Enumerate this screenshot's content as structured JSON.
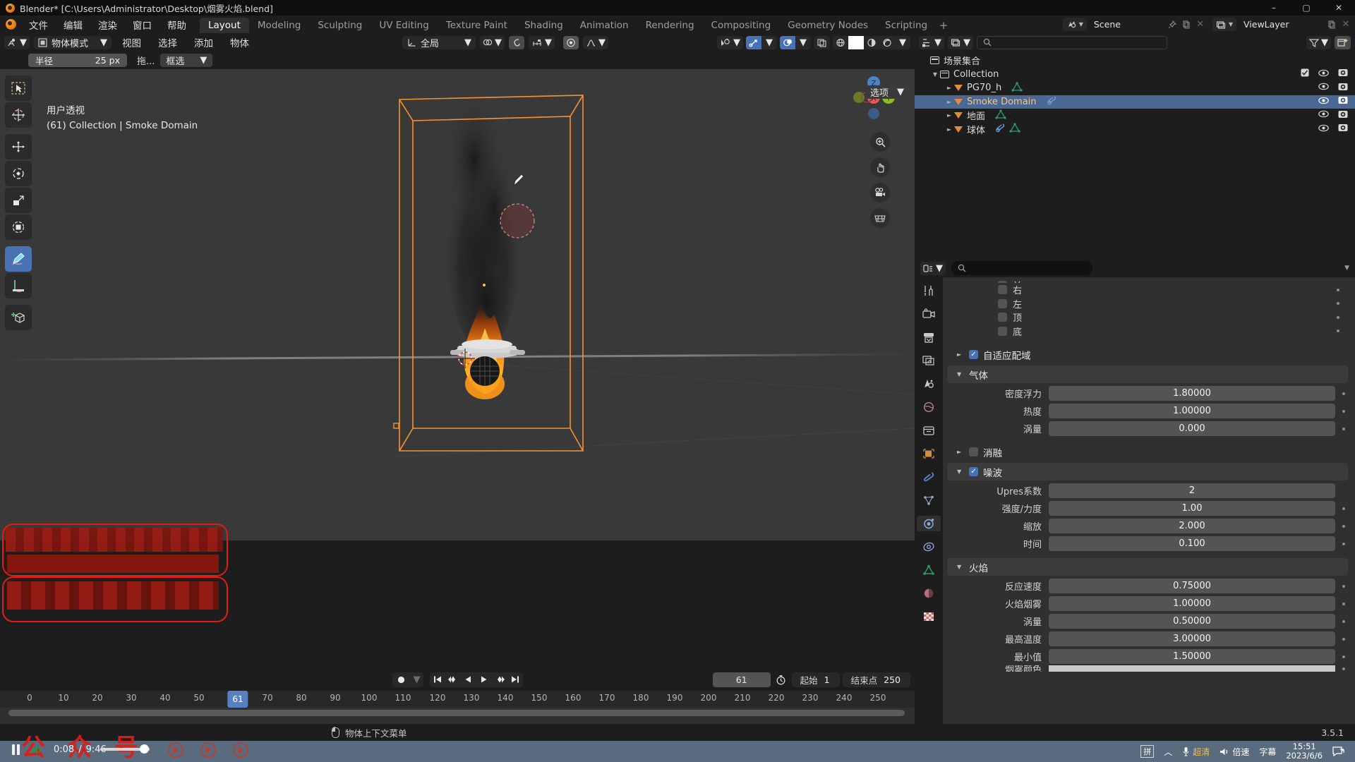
{
  "window": {
    "title": "Blender* [C:\\Users\\Administrator\\Desktop\\烟雾火焰.blend]",
    "minimize": "–",
    "maximize": "▢",
    "close": "✕"
  },
  "topbar": {
    "menus": [
      "文件",
      "编辑",
      "渲染",
      "窗口",
      "帮助"
    ],
    "workspaces": [
      "Layout",
      "Modeling",
      "Sculpting",
      "UV Editing",
      "Texture Paint",
      "Shading",
      "Animation",
      "Rendering",
      "Compositing",
      "Geometry Nodes",
      "Scripting"
    ],
    "active_workspace": "Layout",
    "add_workspace": "+",
    "scene_name": "Scene",
    "viewlayer_name": "ViewLayer"
  },
  "viewport": {
    "header": {
      "mode": "物体模式",
      "menus": [
        "视图",
        "选择",
        "添加",
        "物体"
      ],
      "transform_orientation": "全局",
      "overlay_label": "",
      "icons": {
        "editor_type": "editor-type-icon",
        "mode_icon": "object-mode-icon",
        "orientation_icon": "global-orientation-icon",
        "snap_icon": "magnet-icon",
        "proportional_icon": "proportional-edit-icon",
        "falloff_icon": "falloff-curve-icon",
        "visibility_icon": "object-visibility-icon",
        "gizmo_icon": "gizmo-icon",
        "overlays_icon": "overlays-icon",
        "xray_icon": "xray-icon"
      },
      "shading_modes": [
        "wireframe",
        "solid",
        "material",
        "rendered"
      ],
      "active_shading": "solid"
    },
    "tool_settings": {
      "radius_label": "半径",
      "radius_value": "25 px",
      "drag_label": "拖...",
      "placement_value": "框选"
    },
    "options_label": "选项",
    "overlay_text_line1": "用户透视",
    "overlay_text_line2": "(61) Collection | Smoke Domain",
    "gizmo_axes": [
      "Z",
      "X",
      "Y"
    ],
    "tools": [
      {
        "name": "tweak-tool",
        "label": "调整"
      },
      {
        "name": "cursor-tool",
        "label": "游标"
      },
      {
        "name": "move-tool",
        "label": "移动"
      },
      {
        "name": "rotate-tool",
        "label": "旋转"
      },
      {
        "name": "scale-tool",
        "label": "缩放"
      },
      {
        "name": "transform-tool",
        "label": "变换"
      },
      {
        "name": "annotate-tool",
        "label": "标注"
      },
      {
        "name": "measure-tool",
        "label": "测量"
      },
      {
        "name": "add-cube-tool",
        "label": "添加立方体"
      }
    ],
    "active_tool": "annotate-tool"
  },
  "outliner": {
    "filter_placeholder": "",
    "root_label": "场景集合",
    "items": [
      {
        "label": "Collection",
        "type": "collection",
        "depth": 0,
        "selected": false,
        "has_checkbox": true,
        "modifier_icons": []
      },
      {
        "label": "PG70_h",
        "type": "object",
        "depth": 1,
        "selected": false,
        "has_checkbox": false,
        "modifier_icons": [
          "mesh-data-icon"
        ]
      },
      {
        "label": "Smoke Domain",
        "type": "object",
        "depth": 1,
        "selected": true,
        "has_checkbox": false,
        "modifier_icons": [
          "physics-icon"
        ]
      },
      {
        "label": "地面",
        "type": "object",
        "depth": 1,
        "selected": false,
        "has_checkbox": false,
        "modifier_icons": [
          "mesh-data-icon"
        ]
      },
      {
        "label": "球体",
        "type": "object",
        "depth": 1,
        "selected": false,
        "has_checkbox": false,
        "modifier_icons": [
          "physics-icon",
          "mesh-data-icon"
        ]
      }
    ]
  },
  "properties": {
    "search_placeholder": "",
    "tabs": [
      "tool-tab",
      "render-tab",
      "output-tab",
      "viewlayer-tab",
      "scene-tab",
      "world-tab",
      "collection-tab",
      "object-tab",
      "modifier-tab",
      "particles-tab",
      "physics-tab",
      "constraint-tab",
      "data-tab",
      "material-tab",
      "texture-tab"
    ],
    "active_tab": "physics-tab",
    "partial_checkboxes": [
      {
        "label": "右",
        "checked": false
      },
      {
        "label": "左",
        "checked": false
      },
      {
        "label": "顶",
        "checked": false
      },
      {
        "label": "底",
        "checked": false
      }
    ],
    "sections": [
      {
        "name": "adaptive-domain",
        "title": "自适应配域",
        "checkbox": true,
        "collapsed": true,
        "rows": []
      },
      {
        "name": "gas-section",
        "title": "气体",
        "checkbox": null,
        "collapsed": false,
        "rows": [
          {
            "label": "密度浮力",
            "value": "1.80000"
          },
          {
            "label": "热度",
            "value": "1.00000"
          },
          {
            "label": "涡量",
            "value": "0.000"
          }
        ]
      },
      {
        "name": "dissolve-section",
        "title": "消融",
        "checkbox": false,
        "collapsed": true,
        "rows": []
      },
      {
        "name": "noise-section",
        "title": "噪波",
        "checkbox": true,
        "collapsed": false,
        "rows": [
          {
            "label": "Upres系数",
            "value": "2",
            "no_dot": true
          },
          {
            "label": "强度/力度",
            "value": "1.00"
          },
          {
            "label": "缩放",
            "value": "2.000"
          },
          {
            "label": "时间",
            "value": "0.100"
          }
        ]
      },
      {
        "name": "fire-section",
        "title": "火焰",
        "checkbox": null,
        "collapsed": false,
        "rows": [
          {
            "label": "反应速度",
            "value": "0.75000"
          },
          {
            "label": "火焰烟雾",
            "value": "1.00000"
          },
          {
            "label": "涡量",
            "value": "0.50000"
          },
          {
            "label": "最高温度",
            "value": "3.00000"
          },
          {
            "label": "最小值",
            "value": "1.50000"
          }
        ]
      }
    ],
    "clipped_row_label": "烟雾颜色"
  },
  "timeline": {
    "playback_icons": [
      "jump-start-icon",
      "prev-keyframe-icon",
      "play-reverse-icon",
      "play-icon",
      "next-keyframe-icon",
      "jump-end-icon"
    ],
    "record_icon": "record-icon",
    "current_frame": "61",
    "timer_icon": "timer-icon",
    "start_label": "起始",
    "start_value": "1",
    "end_label": "结束点",
    "end_value": "250",
    "ticks": [
      {
        "label": "0",
        "frame": 0
      },
      {
        "label": "10",
        "frame": 10
      },
      {
        "label": "20",
        "frame": 20
      },
      {
        "label": "30",
        "frame": 30
      },
      {
        "label": "40",
        "frame": 40
      },
      {
        "label": "50",
        "frame": 50
      },
      {
        "label": "70",
        "frame": 70
      },
      {
        "label": "80",
        "frame": 80
      },
      {
        "label": "90",
        "frame": 90
      },
      {
        "label": "100",
        "frame": 100
      },
      {
        "label": "110",
        "frame": 110
      },
      {
        "label": "120",
        "frame": 120
      },
      {
        "label": "130",
        "frame": 130
      },
      {
        "label": "140",
        "frame": 140
      },
      {
        "label": "150",
        "frame": 150
      },
      {
        "label": "160",
        "frame": 160
      },
      {
        "label": "170",
        "frame": 170
      },
      {
        "label": "180",
        "frame": 180
      },
      {
        "label": "190",
        "frame": 190
      },
      {
        "label": "200",
        "frame": 200
      },
      {
        "label": "210",
        "frame": 210
      },
      {
        "label": "220",
        "frame": 220
      },
      {
        "label": "230",
        "frame": 230
      },
      {
        "label": "240",
        "frame": 240
      },
      {
        "label": "250",
        "frame": 250
      }
    ]
  },
  "statusbar": {
    "mouse_hint": "物体上下文菜单",
    "version": "3.5.1"
  },
  "taskbar": {
    "ime": "拼",
    "quality": "超清",
    "speed": "倍速",
    "subtitle": "字幕",
    "time": "15:51",
    "date": "2023/6/6"
  },
  "video_overlay": {
    "current_time": "0:08",
    "total_time": "9:46",
    "separator": "/",
    "pause_icon": "pause-icon",
    "volume_icon": "volume-icon",
    "watermark": "公 众 号"
  }
}
